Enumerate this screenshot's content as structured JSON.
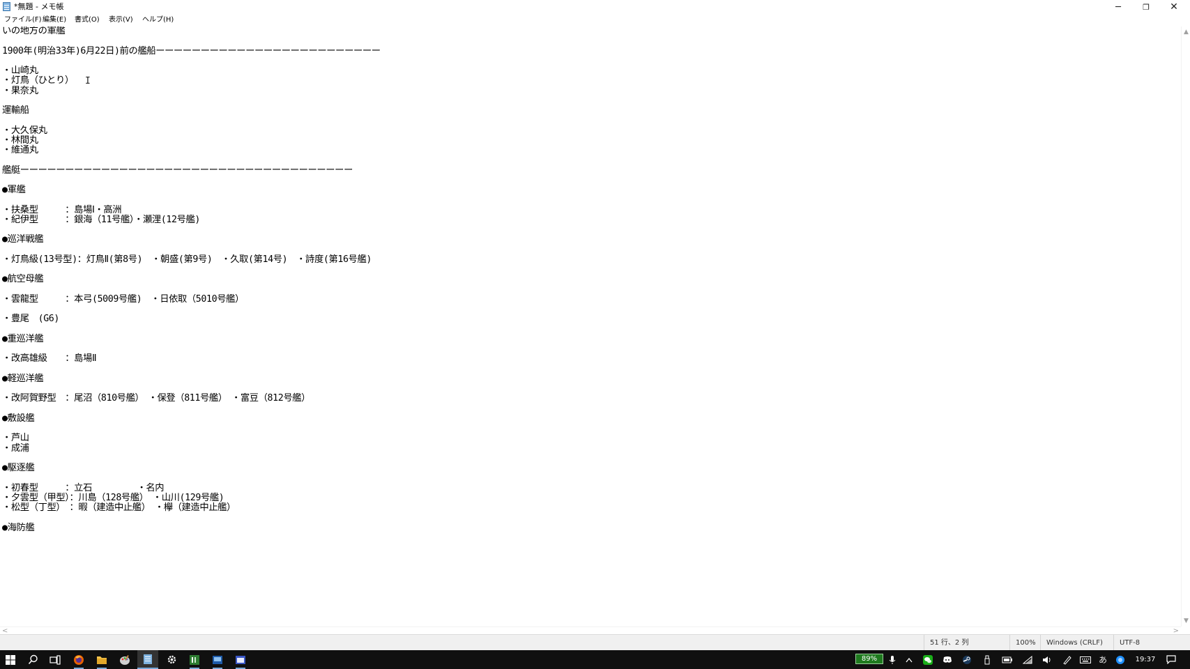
{
  "window": {
    "title": "*無題 - メモ帳",
    "minimize_glyph": "─",
    "maximize_glyph": "❐",
    "close_glyph": "✕"
  },
  "menu": {
    "items": [
      {
        "label": "ファイル(F)"
      },
      {
        "label": "編集(E)"
      },
      {
        "label": "書式(O)"
      },
      {
        "label": "表示(V)"
      },
      {
        "label": "ヘルプ(H)"
      }
    ]
  },
  "editor": {
    "content": "いの地方の軍艦\n\n1900年(明治33年)6月22日)前の艦船ーーーーーーーーーーーーーーーーーーーーーーーーー\n\n・山崎丸\n・灯鳥（ひとり）\n・果奈丸\n\n運輸船\n\n・大久保丸\n・林間丸\n・維通丸\n\n艦艇ーーーーーーーーーーーーーーーーーーーーーーーーーーーーーーーーーーーーー\n\n●軍艦\n\n・扶桑型　　　：島場Ⅰ・高洲\n・紀伊型　　　：銀海（11号艦）・瀬浬(12号艦)\n\n●巡洋戦艦\n\n・灯鳥級(13号型)：灯鳥Ⅱ(第8号)　・朝盛(第9号)　・久取(第14号)　・詩度(第16号艦)\n\n●航空母艦\n\n・雲龍型　　　：本弓(5009号艦)　・日依取（5010号艦）\n\n・豊尾　(G6)\n\n●重巡洋艦\n\n・改高雄級　　：島場Ⅱ\n\n●軽巡洋艦\n\n・改阿賀野型　：尾沼（810号艦）　・保登（811号艦）　・富豆（812号艦）\n\n●敷設艦\n\n・芦山\n・成浦\n\n●駆逐艦\n\n・初春型　　　：立石　　　　　・名内\n・夕雲型（甲型）：川島（128号艦）　・山川(129号艦)\n・松型（丁型）　：暇（建造中止艦）　・欅（建造中止艦）\n\n●海防艦",
    "caret_glyph": "I"
  },
  "scrollbars": {
    "up_arrow": "▲",
    "down_arrow": "▼",
    "left_arrow": "<",
    "right_arrow": ">"
  },
  "status": {
    "position": "51 行、2 列",
    "zoom": "100%",
    "line_ending": "Windows (CRLF)",
    "encoding": "UTF-8"
  },
  "taskbar": {
    "battery": "89%",
    "time": "19:37",
    "icons": [
      "windows-start-icon",
      "search-icon",
      "task-view-icon",
      "firefox-icon",
      "file-explorer-icon",
      "paint-icon",
      "notepad-icon",
      "settings-icon",
      "app-terminal-icon",
      "app-blue-icon",
      "app-window-icon"
    ],
    "tray_icons": [
      "mic-icon",
      "chevron-up-icon",
      "wechat-icon",
      "discord-icon",
      "steam-icon",
      "usb-icon",
      "battery-icon",
      "wifi-icon",
      "volume-icon",
      "pen-icon",
      "keyboard-icon",
      "ime-icon",
      "onedrive-icon"
    ],
    "ime_label": "あ"
  },
  "colors": {
    "taskbar_bg": "#101010",
    "battery_bg": "#1f7a1f",
    "active_indicator": "#78a8d8"
  }
}
